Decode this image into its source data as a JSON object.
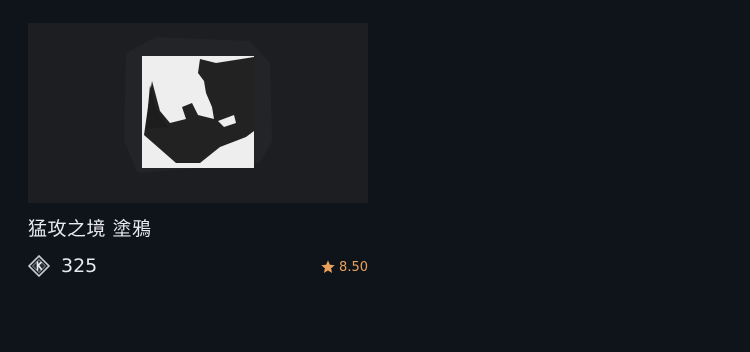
{
  "card": {
    "title": "猛攻之境 塗鴉",
    "price": "325",
    "rating": "8.50",
    "icons": {
      "thumbnail": "rhino-graffiti-image",
      "currency": "coin-icon",
      "rating": "star-icon"
    },
    "colors": {
      "background": "#0f141b",
      "thumb_background": "#1c1e22",
      "rating": "#e8a15a",
      "text": "#e8eaed"
    }
  }
}
